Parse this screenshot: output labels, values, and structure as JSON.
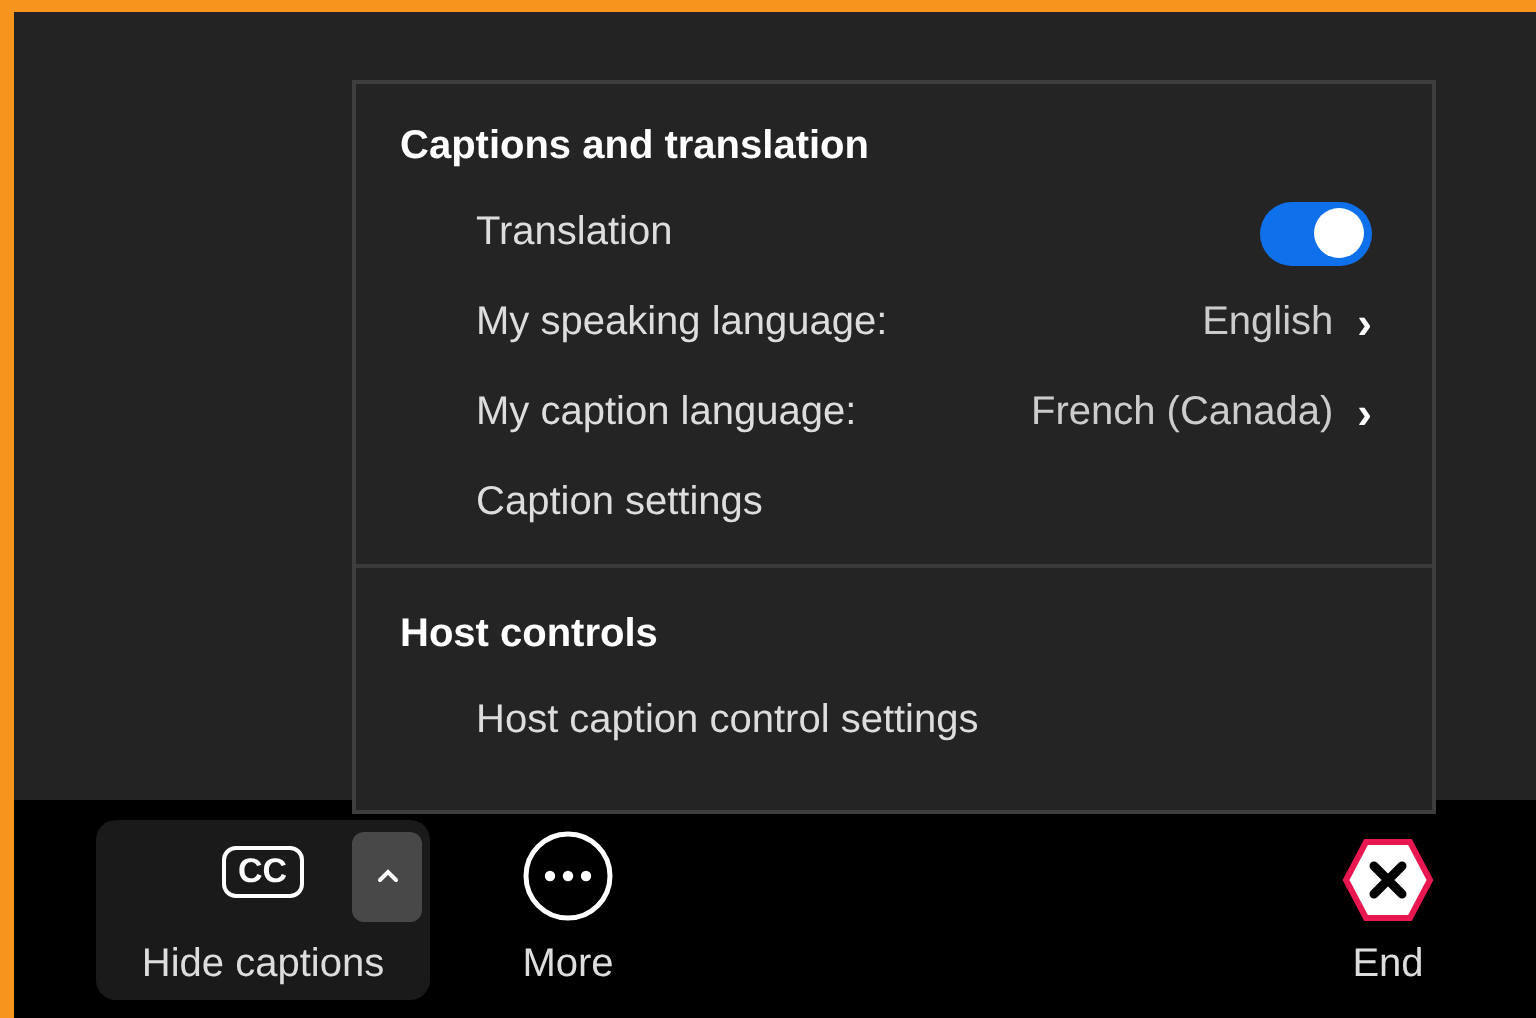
{
  "menu": {
    "sections": [
      {
        "title": "Captions and translation",
        "items": [
          {
            "kind": "toggle",
            "label": "Translation",
            "on": true
          },
          {
            "kind": "submenu",
            "label": "My speaking language:",
            "value": "English",
            "arrow": "›"
          },
          {
            "kind": "submenu",
            "label": "My caption language:",
            "value": "French (Canada)",
            "arrow": "›"
          },
          {
            "kind": "plain",
            "label": "Caption settings"
          }
        ]
      },
      {
        "title": "Host controls",
        "items": [
          {
            "kind": "plain",
            "label": "Host caption control settings"
          }
        ]
      }
    ]
  },
  "toolbar": [
    {
      "kind": "captions",
      "label": "Hide captions",
      "icon_text": "CC",
      "expanded": true
    },
    {
      "kind": "more",
      "label": "More"
    },
    {
      "kind": "end",
      "label": "End"
    }
  ]
}
